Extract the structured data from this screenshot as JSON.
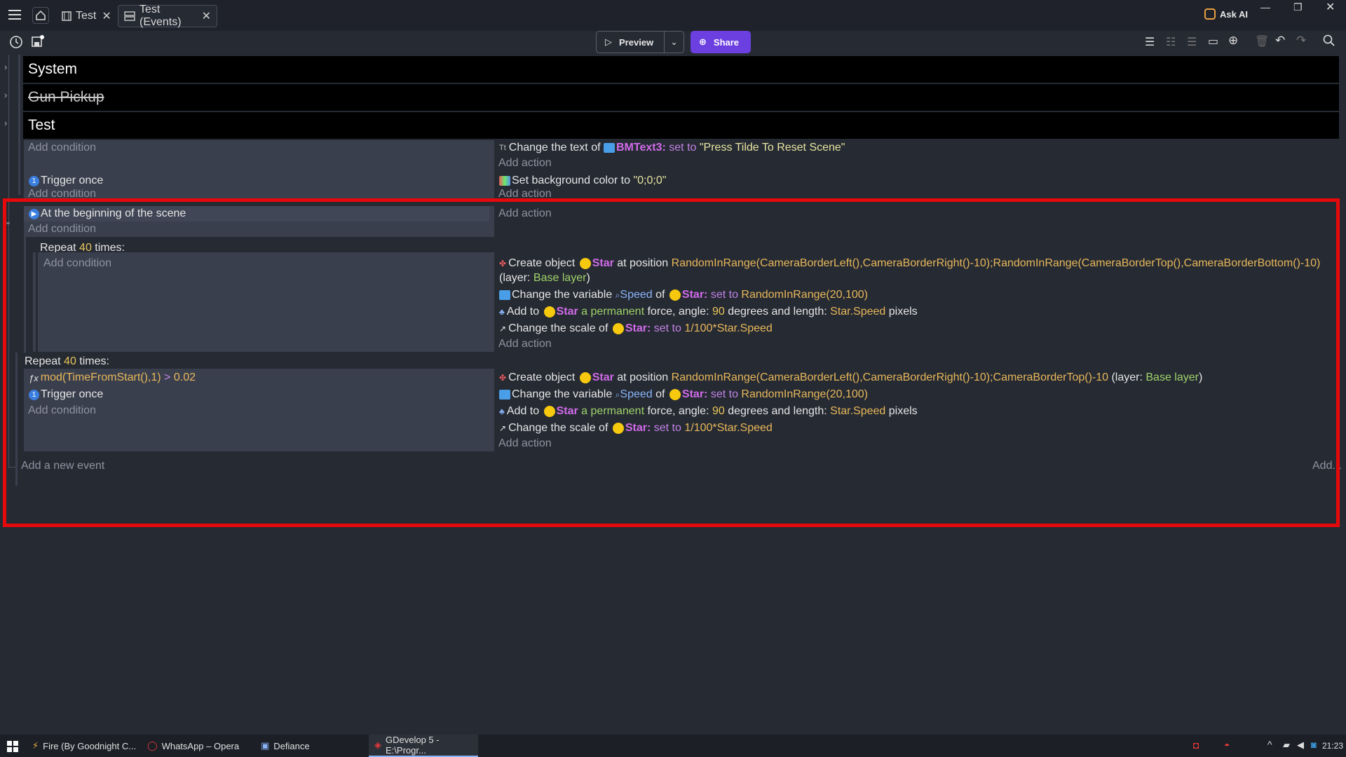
{
  "tabs": [
    {
      "label": "Test"
    },
    {
      "label": "Test (Events)"
    }
  ],
  "title_actions": {
    "ask_ai": "Ask AI"
  },
  "toolbar": {
    "preview_label": "Preview",
    "share_label": "Share"
  },
  "groups": [
    {
      "label": "System"
    },
    {
      "label": "Gun Pickup"
    },
    {
      "label": "Test"
    }
  ],
  "event1": {
    "add_condition": "Add condition",
    "action_text_prefix": "Change the text of",
    "action_obj": "BMText3:",
    "action_setto": "set to",
    "action_value": "\"Press Tilde To Reset Scene\"",
    "add_action": "Add action"
  },
  "event2": {
    "condition": "Trigger once",
    "add_condition": "Add condition",
    "action_prefix": "Set background color to",
    "action_value": "\"0;0;0\"",
    "add_action": "Add action"
  },
  "event3": {
    "condition": "At the beginning of the scene",
    "add_condition": "Add condition",
    "add_action": "Add action"
  },
  "repeat1": {
    "repeat": "Repeat",
    "count": "40",
    "times": "times:",
    "add_condition": "Add condition",
    "a1_prefix": "Create object",
    "a1_obj": "Star",
    "a1_mid": "at position",
    "a1_expr": "RandomInRange(CameraBorderLeft(),CameraBorderRight()-10);RandomInRange(CameraBorderTop(),CameraBorderBottom()-10)",
    "a1_layer_prefix": "(layer:",
    "a1_layer": "Base layer",
    "a1_layer_suffix": ")",
    "a2_prefix": "Change the variable",
    "a2_var": "Speed",
    "a2_of": "of",
    "a2_obj": "Star:",
    "a2_setto": "set to",
    "a2_value": "RandomInRange(20,100)",
    "a3_prefix": "Add to",
    "a3_obj": "Star",
    "a3_perm": "a permanent",
    "a3_mid": "force, angle:",
    "a3_angle": "90",
    "a3_mid2": "degrees and length:",
    "a3_len": "Star.Speed",
    "a3_suffix": "pixels",
    "a4_prefix": "Change the scale of",
    "a4_obj": "Star:",
    "a4_setto": "set to",
    "a4_value": "1/100*Star.Speed",
    "add_action": "Add action"
  },
  "repeat2": {
    "repeat": "Repeat",
    "count": "40",
    "times": "times:",
    "cond1_expr": "mod(TimeFromStart(),1)",
    "cond1_op": ">",
    "cond1_val": "0.02",
    "cond2": "Trigger once",
    "add_condition": "Add condition",
    "a1_prefix": "Create object",
    "a1_obj": "Star",
    "a1_mid": "at position",
    "a1_expr": "RandomInRange(CameraBorderLeft(),CameraBorderRight()-10);CameraBorderTop()-10",
    "a1_layer_prefix": "(layer:",
    "a1_layer": "Base layer",
    "a1_layer_suffix": ")",
    "a2_prefix": "Change the variable",
    "a2_var": "Speed",
    "a2_of": "of",
    "a2_obj": "Star:",
    "a2_setto": "set to",
    "a2_value": "RandomInRange(20,100)",
    "a3_prefix": "Add to",
    "a3_obj": "Star",
    "a3_perm": "a permanent",
    "a3_mid": "force, angle:",
    "a3_angle": "90",
    "a3_mid2": "degrees and length:",
    "a3_len": "Star.Speed",
    "a3_suffix": "pixels",
    "a4_prefix": "Change the scale of",
    "a4_obj": "Star:",
    "a4_setto": "set to",
    "a4_value": "1/100*Star.Speed",
    "add_action": "Add action"
  },
  "footer": {
    "add_event": "Add a new event",
    "add": "Add..."
  },
  "taskbar": {
    "items": [
      {
        "label": "Fire (By Goodnight C..."
      },
      {
        "label": "WhatsApp – Opera"
      },
      {
        "label": "Defiance"
      },
      {
        "label": "GDevelop 5 - E:\\Progr..."
      }
    ],
    "clock": "21:23"
  },
  "colors": {
    "highlight_border": "#e5090c",
    "share_button": "#6b3fe0"
  }
}
